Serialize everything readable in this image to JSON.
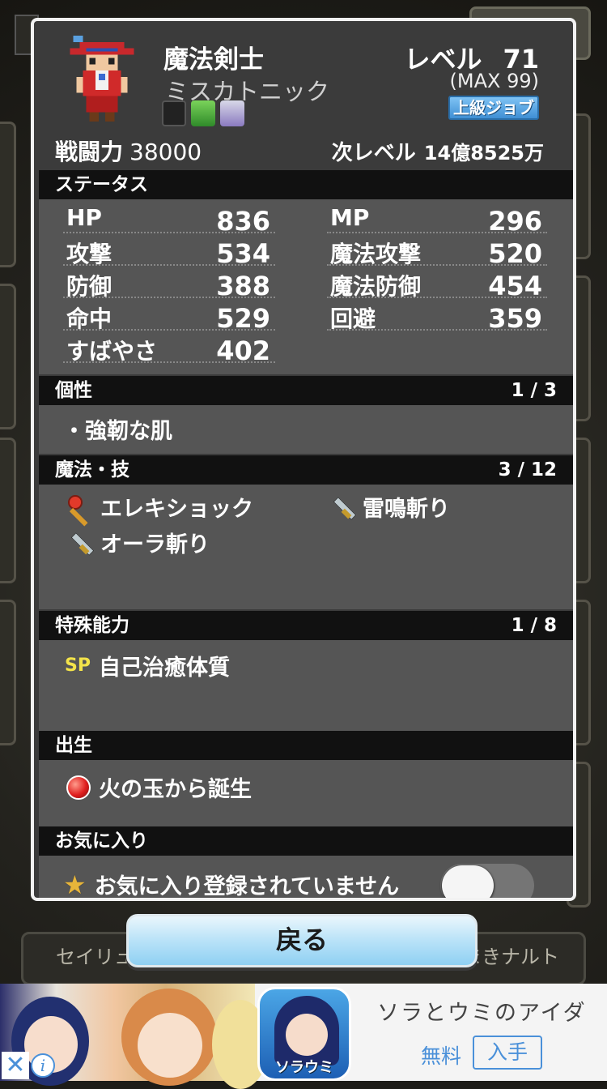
{
  "character": {
    "class_name": "魔法剣士",
    "nickname": "ミスカトニック",
    "level_label": "レベル",
    "level": "71",
    "max_level": "(MAX 99)",
    "job_badge": "上級ジョブ",
    "power_label": "戦闘力",
    "power": "38000",
    "next_level_label": "次レベル",
    "next_level_exp": "14億8525万"
  },
  "status": {
    "header": "ステータス",
    "left": [
      {
        "label": "HP",
        "value": "836"
      },
      {
        "label": "攻撃",
        "value": "534"
      },
      {
        "label": "防御",
        "value": "388"
      },
      {
        "label": "命中",
        "value": "529"
      },
      {
        "label": "すばやさ",
        "value": "402"
      }
    ],
    "right": [
      {
        "label": "MP",
        "value": "296"
      },
      {
        "label": "魔法攻撃",
        "value": "520"
      },
      {
        "label": "魔法防御",
        "value": "454"
      },
      {
        "label": "回避",
        "value": "359"
      }
    ]
  },
  "traits": {
    "header": "個性",
    "count": "1 / 3",
    "items": [
      "・強靭な肌"
    ]
  },
  "skills": {
    "header": "魔法・技",
    "count": "3 / 12",
    "items": [
      {
        "name": "エレキショック",
        "icon": "wand-icon"
      },
      {
        "name": "雷鳴斬り",
        "icon": "sword-icon"
      },
      {
        "name": "オーラ斬り",
        "icon": "sword-icon"
      }
    ]
  },
  "abilities": {
    "header": "特殊能力",
    "count": "1 / 8",
    "sp_tag": "SP",
    "items": [
      "自己治癒体質"
    ]
  },
  "birth": {
    "header": "出生",
    "text": "火の玉から誕生"
  },
  "favorite": {
    "header": "お気に入り",
    "text": "お気に入り登録されていません",
    "toggle_on": false
  },
  "back_button": "戻る",
  "background": {
    "bottom_left": "セイリュ",
    "bottom_right": "まきナルト"
  },
  "ad": {
    "title": "ソラとウミのアイダ",
    "free": "無料",
    "get": "入手",
    "icon_label": "ソラウミ"
  }
}
